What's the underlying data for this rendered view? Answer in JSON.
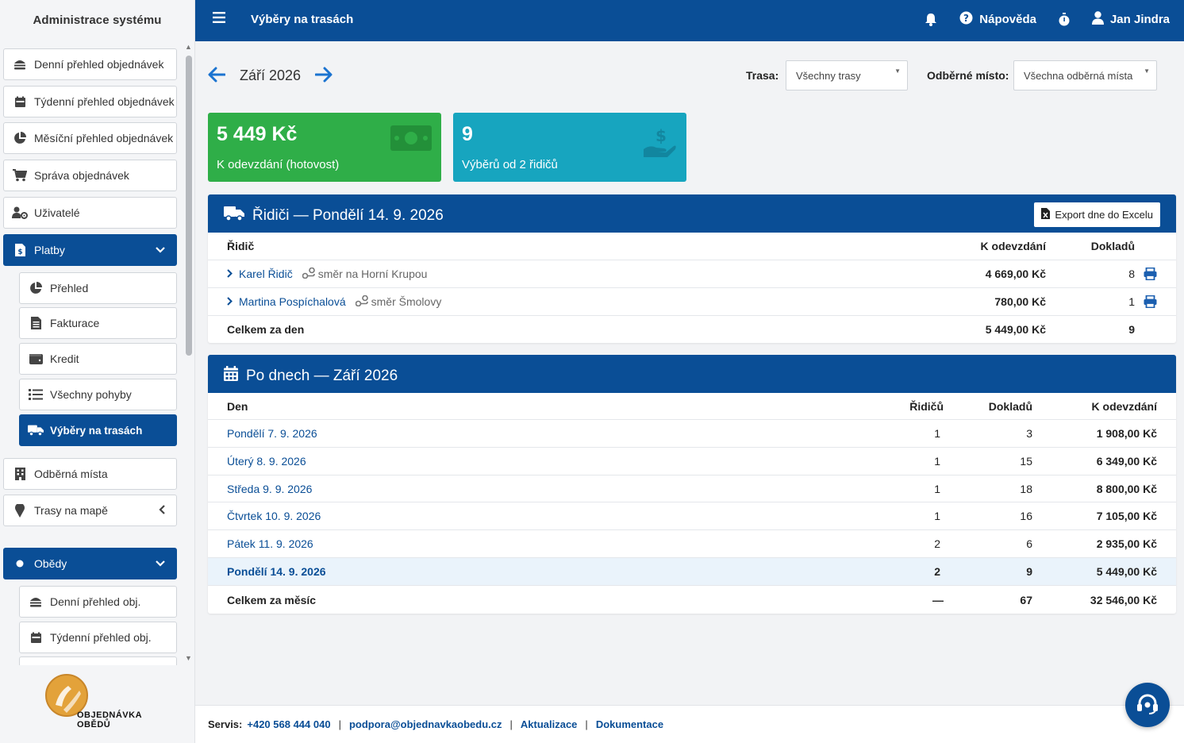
{
  "sidebar": {
    "title": "Administrace systému",
    "items": [
      {
        "label": "Denní přehled objednávek",
        "icon": "hamburger-food-icon"
      },
      {
        "label": "Týdenní přehled objednávek",
        "icon": "calendar-week-icon"
      },
      {
        "label": "Měsíční přehled objednávek",
        "icon": "pie-chart-icon"
      },
      {
        "label": "Správa objednávek",
        "icon": "cart-icon"
      },
      {
        "label": "Uživatelé",
        "icon": "users-gear-icon"
      },
      {
        "label": "Platby",
        "icon": "invoice-dollar-icon",
        "active": true,
        "expanded": true
      }
    ],
    "platby_sub": [
      {
        "label": "Přehled",
        "icon": "pie-chart-icon"
      },
      {
        "label": "Fakturace",
        "icon": "file-invoice-icon"
      },
      {
        "label": "Kredit",
        "icon": "wallet-icon"
      },
      {
        "label": "Všechny pohyby",
        "icon": "list-icon"
      },
      {
        "label": "Výběry na trasách",
        "icon": "truck-icon",
        "active": true
      }
    ],
    "items2": [
      {
        "label": "Odběrná místa",
        "icon": "building-icon"
      },
      {
        "label": "Trasy na mapě",
        "icon": "map-pin-icon"
      }
    ],
    "obedy": {
      "label": "Obědy",
      "icon": "dot-icon"
    },
    "obedy_sub": [
      {
        "label": "Denní přehled obj.",
        "icon": "hamburger-food-icon"
      },
      {
        "label": "Týdenní přehled obj.",
        "icon": "calendar-week-icon"
      }
    ],
    "logo": {
      "line1": "OBJEDNÁVKA",
      "line2": "OBĚDŮ"
    }
  },
  "header": {
    "title": "Výběry na trasách",
    "help": "Nápověda",
    "user": "Jan Jindra"
  },
  "month_nav": {
    "label": "Září 2026"
  },
  "filters": {
    "trasa_label": "Trasa:",
    "trasa_value": "Všechny trasy",
    "misto_label": "Odběrné místo:",
    "misto_value": "Všechna odběrná místa"
  },
  "cards": [
    {
      "value": "5 449 Kč",
      "label": "K odevzdání (hotovost)",
      "color": "#2fae48"
    },
    {
      "value": "9",
      "label": "Výběrů od 2 řidičů",
      "color": "#17a5bf"
    }
  ],
  "drivers_panel": {
    "title": "Řidiči — Pondělí 14. 9. 2026",
    "export": "Export dne do Excelu",
    "headers": {
      "driver": "Řidič",
      "amount": "K odevzdání",
      "docs": "Dokladů"
    },
    "rows": [
      {
        "name": "Karel Řidič",
        "route": "směr na Horní Krupou",
        "amount": "4 669,00 Kč",
        "docs": "8"
      },
      {
        "name": "Martina Pospíchalová",
        "route": "směr Šmolovy",
        "amount": "780,00 Kč",
        "docs": "1"
      }
    ],
    "total": {
      "label": "Celkem za den",
      "amount": "5 449,00 Kč",
      "docs": "9"
    }
  },
  "days_panel": {
    "title": "Po dnech — Září 2026",
    "headers": {
      "day": "Den",
      "drivers": "Řidičů",
      "docs": "Dokladů",
      "amount": "K odevzdání"
    },
    "rows": [
      {
        "day": "Pondělí 7. 9. 2026",
        "drivers": "1",
        "docs": "3",
        "amount": "1 908,00 Kč"
      },
      {
        "day": "Úterý 8. 9. 2026",
        "drivers": "1",
        "docs": "15",
        "amount": "6 349,00 Kč"
      },
      {
        "day": "Středa 9. 9. 2026",
        "drivers": "1",
        "docs": "18",
        "amount": "8 800,00 Kč"
      },
      {
        "day": "Čtvrtek 10. 9. 2026",
        "drivers": "1",
        "docs": "16",
        "amount": "7 105,00 Kč"
      },
      {
        "day": "Pátek 11. 9. 2026",
        "drivers": "2",
        "docs": "6",
        "amount": "2 935,00 Kč"
      },
      {
        "day": "Pondělí 14. 9. 2026",
        "drivers": "2",
        "docs": "9",
        "amount": "5 449,00 Kč",
        "highlight": true
      }
    ],
    "total": {
      "label": "Celkem za měsíc",
      "drivers": "—",
      "docs": "67",
      "amount": "32 546,00 Kč"
    }
  },
  "footer": {
    "servis": "Servis:",
    "phone": "+420 568 444 040",
    "email": "podpora@objednavkaobedu.cz",
    "updates": "Aktualizace",
    "docs": "Dokumentace"
  },
  "colors": {
    "brand": "#0a4e96",
    "green": "#2fae48",
    "teal": "#17a5bf"
  }
}
